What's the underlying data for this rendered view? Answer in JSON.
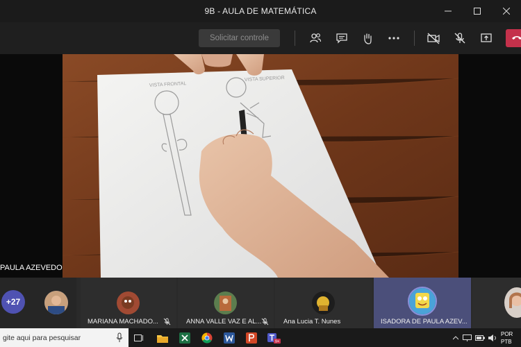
{
  "window": {
    "title": "9B - AULA DE MATEMÁTICA"
  },
  "toolbar": {
    "request_control_label": "Solicitar controle",
    "icons": [
      "participants-icon",
      "chat-icon",
      "raise-hand-icon",
      "more-options-icon",
      "camera-off-icon",
      "mic-off-icon",
      "share-screen-icon",
      "leave-call-icon"
    ]
  },
  "stage": {
    "presenter_name": "PAULA AZEVEDO",
    "paper_labels": {
      "left": "VISTA FRONTAL",
      "right": "VISTA SUPERIOR"
    }
  },
  "participants": {
    "overflow_count": "+27",
    "tiles": [
      {
        "name": "MARIANA MACHADO...",
        "muted": true
      },
      {
        "name": "ANNA VALLE VAZ E AL...",
        "muted": true
      },
      {
        "name": "Ana Lucia T. Nunes",
        "muted": false
      },
      {
        "name": "ISADORA DE PAULA AZEV...",
        "muted": false,
        "active": true
      }
    ]
  },
  "taskbar": {
    "search_placeholder": "gite aqui para pesquisar",
    "teams_badge": "9+",
    "language": "POR",
    "layout": "PTB"
  },
  "colors": {
    "accent": "#4f52b2",
    "leave": "#c4314b",
    "active_tile": "#4b4f7a"
  }
}
